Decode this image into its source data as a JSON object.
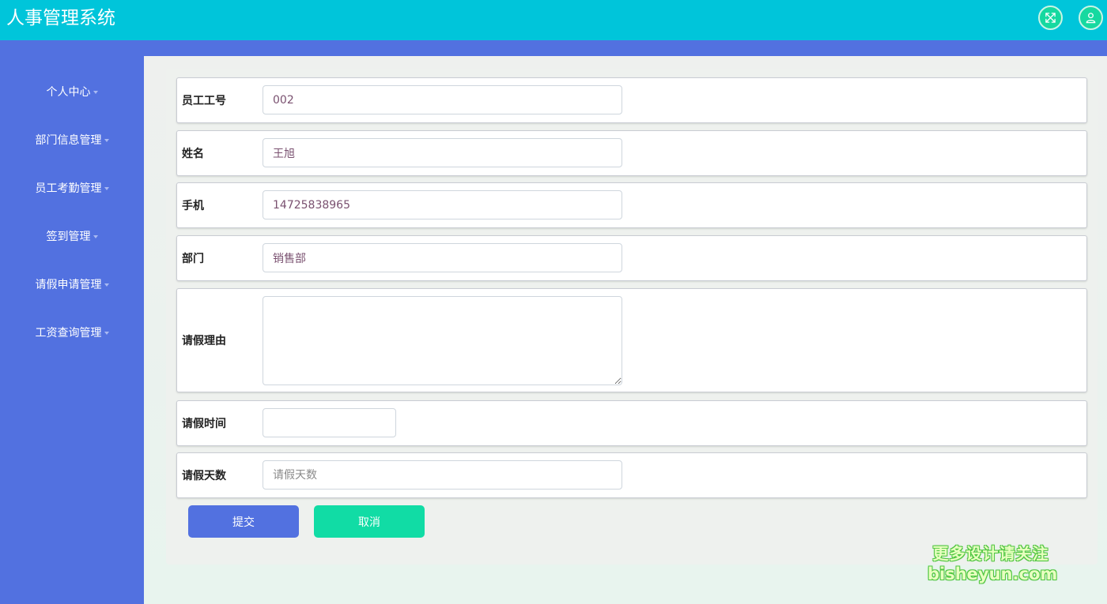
{
  "header": {
    "title": "人事管理系统",
    "fullscreen_icon": "expand-arrows-icon",
    "user_icon": "user-icon"
  },
  "sidebar": {
    "items": [
      {
        "label": "个人中心"
      },
      {
        "label": "部门信息管理"
      },
      {
        "label": "员工考勤管理"
      },
      {
        "label": "签到管理"
      },
      {
        "label": "请假申请管理"
      },
      {
        "label": "工资查询管理"
      }
    ]
  },
  "form": {
    "employee_no": {
      "label": "员工工号",
      "value": "002"
    },
    "name": {
      "label": "姓名",
      "value": "王旭"
    },
    "phone": {
      "label": "手机",
      "value": "14725838965"
    },
    "department": {
      "label": "部门",
      "value": "销售部"
    },
    "reason": {
      "label": "请假理由",
      "value": ""
    },
    "leave_time": {
      "label": "请假时间",
      "value": ""
    },
    "leave_days": {
      "label": "请假天数",
      "placeholder": "请假天数",
      "value": ""
    }
  },
  "actions": {
    "submit_label": "提交",
    "cancel_label": "取消"
  },
  "watermark": {
    "line1": "更多设计请关注",
    "line2": "bisheyun.com"
  },
  "colors": {
    "header_bg": "#00c5da",
    "sidebar_bg": "#5271e0",
    "submit_bg": "#5271e0",
    "cancel_bg": "#11dca5",
    "header_button_bg": "#16d9a0"
  }
}
